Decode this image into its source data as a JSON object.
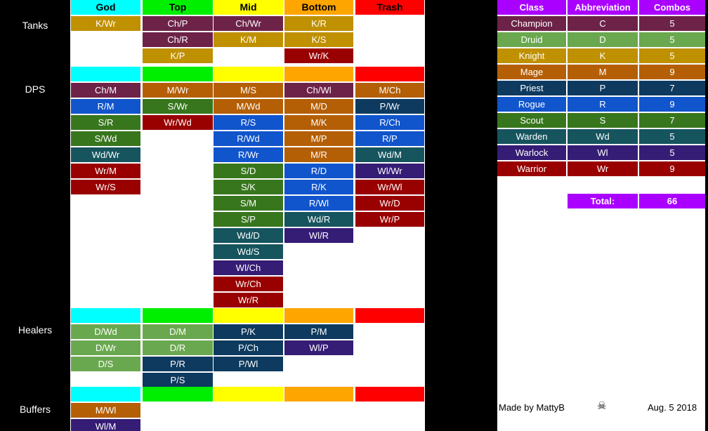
{
  "palette": {
    "god": "#00ffff",
    "top": "#00ee00",
    "mid": "#ffff00",
    "bottom": "#ffa500",
    "trash": "#ff0000",
    "champion": "#6d2348",
    "druid": "#6aa84f",
    "knight": "#bf9000",
    "mage": "#b45f06",
    "priest": "#0e3a5f",
    "rogue": "#1155cc",
    "scout": "#38761d",
    "warden": "#16545e",
    "warlock": "#351c75",
    "warrior": "#990000",
    "total": "#aa00ff",
    "black": "#000000",
    "white": "#ffffff"
  },
  "roles": [
    {
      "label": "Tanks"
    },
    {
      "label": "DPS"
    },
    {
      "label": "Healers"
    },
    {
      "label": "Buffers"
    }
  ],
  "columns": [
    {
      "key": "god",
      "label": "God"
    },
    {
      "key": "top",
      "label": "Top"
    },
    {
      "key": "mid",
      "label": "Mid"
    },
    {
      "key": "bottom",
      "label": "Bottom"
    },
    {
      "key": "trash",
      "label": "Trash"
    }
  ],
  "sections": [
    {
      "role": "Tanks",
      "header_labeled": true,
      "columns": [
        {
          "key": "god",
          "cells": [
            {
              "text": "K/Wr",
              "color": "knight"
            }
          ]
        },
        {
          "key": "top",
          "cells": [
            {
              "text": "Ch/P",
              "color": "champion"
            },
            {
              "text": "Ch/R",
              "color": "champion"
            },
            {
              "text": "K/P",
              "color": "knight"
            }
          ]
        },
        {
          "key": "mid",
          "cells": [
            {
              "text": "Ch/Wr",
              "color": "champion"
            },
            {
              "text": "K/M",
              "color": "knight"
            }
          ]
        },
        {
          "key": "bottom",
          "cells": [
            {
              "text": "K/R",
              "color": "knight"
            },
            {
              "text": "K/S",
              "color": "knight"
            },
            {
              "text": "Wr/K",
              "color": "warrior"
            }
          ]
        },
        {
          "key": "trash",
          "cells": []
        }
      ]
    },
    {
      "role": "DPS",
      "header_labeled": false,
      "columns": [
        {
          "key": "god",
          "cells": [
            {
              "text": "Ch/M",
              "color": "champion"
            },
            {
              "text": "R/M",
              "color": "rogue"
            },
            {
              "text": "S/R",
              "color": "scout"
            },
            {
              "text": "S/Wd",
              "color": "scout"
            },
            {
              "text": "Wd/Wr",
              "color": "warden"
            },
            {
              "text": "Wr/M",
              "color": "warrior"
            },
            {
              "text": "Wr/S",
              "color": "warrior"
            }
          ]
        },
        {
          "key": "top",
          "cells": [
            {
              "text": "M/Wr",
              "color": "mage"
            },
            {
              "text": "S/Wr",
              "color": "scout"
            },
            {
              "text": "Wr/Wd",
              "color": "warrior"
            }
          ]
        },
        {
          "key": "mid",
          "cells": [
            {
              "text": "M/S",
              "color": "mage"
            },
            {
              "text": "M/Wd",
              "color": "mage"
            },
            {
              "text": "R/S",
              "color": "rogue"
            },
            {
              "text": "R/Wd",
              "color": "rogue"
            },
            {
              "text": "R/Wr",
              "color": "rogue"
            },
            {
              "text": "S/D",
              "color": "scout"
            },
            {
              "text": "S/K",
              "color": "scout"
            },
            {
              "text": "S/M",
              "color": "scout"
            },
            {
              "text": "S/P",
              "color": "scout"
            },
            {
              "text": "Wd/D",
              "color": "warden"
            },
            {
              "text": "Wd/S",
              "color": "warden"
            },
            {
              "text": "Wl/Ch",
              "color": "warlock"
            },
            {
              "text": "Wr/Ch",
              "color": "warrior"
            },
            {
              "text": "Wr/R",
              "color": "warrior"
            }
          ]
        },
        {
          "key": "bottom",
          "cells": [
            {
              "text": "Ch/Wl",
              "color": "champion"
            },
            {
              "text": "M/D",
              "color": "mage"
            },
            {
              "text": "M/K",
              "color": "mage"
            },
            {
              "text": "M/P",
              "color": "mage"
            },
            {
              "text": "M/R",
              "color": "mage"
            },
            {
              "text": "R/D",
              "color": "rogue"
            },
            {
              "text": "R/K",
              "color": "rogue"
            },
            {
              "text": "R/Wl",
              "color": "rogue"
            },
            {
              "text": "Wd/R",
              "color": "warden"
            },
            {
              "text": "Wl/R",
              "color": "warlock"
            }
          ]
        },
        {
          "key": "trash",
          "cells": [
            {
              "text": "M/Ch",
              "color": "mage"
            },
            {
              "text": "P/Wr",
              "color": "priest"
            },
            {
              "text": "R/Ch",
              "color": "rogue"
            },
            {
              "text": "R/P",
              "color": "rogue"
            },
            {
              "text": "Wd/M",
              "color": "warden"
            },
            {
              "text": "Wl/Wr",
              "color": "warlock"
            },
            {
              "text": "Wr/Wl",
              "color": "warrior"
            },
            {
              "text": "Wr/D",
              "color": "warrior"
            },
            {
              "text": "Wr/P",
              "color": "warrior"
            }
          ]
        }
      ]
    },
    {
      "role": "Healers",
      "header_labeled": false,
      "columns": [
        {
          "key": "god",
          "cells": [
            {
              "text": "D/Wd",
              "color": "druid"
            },
            {
              "text": "D/Wr",
              "color": "druid"
            },
            {
              "text": "D/S",
              "color": "druid"
            }
          ]
        },
        {
          "key": "top",
          "cells": [
            {
              "text": "D/M",
              "color": "druid"
            },
            {
              "text": "D/R",
              "color": "druid"
            },
            {
              "text": "P/R",
              "color": "priest"
            },
            {
              "text": "P/S",
              "color": "priest"
            }
          ]
        },
        {
          "key": "mid",
          "cells": [
            {
              "text": "P/K",
              "color": "priest"
            },
            {
              "text": "P/Ch",
              "color": "priest"
            },
            {
              "text": "P/Wl",
              "color": "priest"
            }
          ]
        },
        {
          "key": "bottom",
          "cells": [
            {
              "text": "P/M",
              "color": "priest"
            },
            {
              "text": "Wl/P",
              "color": "warlock"
            }
          ]
        },
        {
          "key": "trash",
          "cells": []
        }
      ]
    },
    {
      "role": "Buffers",
      "header_labeled": false,
      "columns": [
        {
          "key": "god",
          "cells": [
            {
              "text": "M/Wl",
              "color": "mage"
            },
            {
              "text": "Wl/M",
              "color": "warlock"
            }
          ]
        },
        {
          "key": "top",
          "cells": []
        },
        {
          "key": "mid",
          "cells": []
        },
        {
          "key": "bottom",
          "cells": []
        },
        {
          "key": "trash",
          "cells": []
        }
      ]
    }
  ],
  "legend": {
    "headers": [
      "Class",
      "Abbreviation",
      "Combos"
    ],
    "header_color": "total",
    "rows": [
      {
        "class": "Champion",
        "abbr": "C",
        "combos": "5",
        "color": "champion"
      },
      {
        "class": "Druid",
        "abbr": "D",
        "combos": "5",
        "color": "druid"
      },
      {
        "class": "Knight",
        "abbr": "K",
        "combos": "5",
        "color": "knight"
      },
      {
        "class": "Mage",
        "abbr": "M",
        "combos": "9",
        "color": "mage"
      },
      {
        "class": "Priest",
        "abbr": "P",
        "combos": "7",
        "color": "priest"
      },
      {
        "class": "Rogue",
        "abbr": "R",
        "combos": "9",
        "color": "rogue"
      },
      {
        "class": "Scout",
        "abbr": "S",
        "combos": "7",
        "color": "scout"
      },
      {
        "class": "Warden",
        "abbr": "Wd",
        "combos": "5",
        "color": "warden"
      },
      {
        "class": "Warlock",
        "abbr": "Wl",
        "combos": "5",
        "color": "warlock"
      },
      {
        "class": "Warrior",
        "abbr": "Wr",
        "combos": "9",
        "color": "warrior"
      }
    ],
    "total_label": "Total:",
    "total_value": "66"
  },
  "footer": {
    "credit": "Made by MattyB",
    "skull": "☠",
    "date": "Aug. 5 2018"
  }
}
